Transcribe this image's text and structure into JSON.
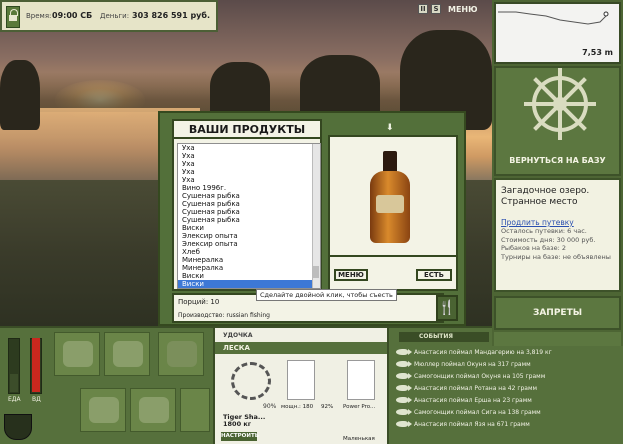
{
  "status": {
    "time_label": "Время:",
    "time_value": "09:00 СБ",
    "money_label": "Деньги:",
    "money_value": "303 826 591 руб."
  },
  "top_buttons": {
    "b1": "II",
    "b2": "S",
    "menu": "МЕНЮ"
  },
  "minimap": {
    "depth": "7,53 m"
  },
  "right_panel": {
    "back_to_base": "ВЕРНУТЬСЯ НА БАЗУ",
    "lake_name": "Загадочное озеро. Странное место",
    "extend_link": "Продлить путевку",
    "lines": [
      "Осталось путевки: 6 час.",
      "Стоимость дня: 30 000 руб.",
      "Рыбаков на базе: 2",
      "Турниры на базе: не объявлены"
    ],
    "bans": "ЗАПРЕТЫ"
  },
  "dialog": {
    "title": "ВАШИ ПРОДУКТЫ",
    "items": [
      "Уха",
      "Уха",
      "Уха",
      "Уха",
      "Уха",
      "Вино 1996г.",
      "Сушеная рыбка",
      "Сушеная рыбка",
      "Сушеная рыбка",
      "Сушеная рыбка",
      "Виски",
      "Элексир опыта",
      "Элексир опыта",
      "Хлеб",
      "Минералка",
      "Минералка",
      "Виски",
      "Виски"
    ],
    "selected_index": 17,
    "menu_btn": "МЕНЮ",
    "eat_btn": "ЕСТЬ",
    "arrow": "⬇",
    "portions": "Порций: 10",
    "maker": "Производство: russian fishing",
    "tooltip": "Сделайте двойной клик, чтобы съесть",
    "eat_icon": "🍴"
  },
  "bottom": {
    "gauge_left_label": "ЕДА",
    "gauge_right_label": "ВД",
    "tackle_top": "УДОЧКА",
    "tackle_header": "ЛЕСКА",
    "rod_name": "Tiger Sha...\n1800 кг",
    "rod_pct": "90%",
    "setup": "НАСТРОИТЬ",
    "line_label": "мощн.: 180",
    "line_pct": "92%",
    "lure_label": "Power Pro...",
    "small_label": "Маленькая",
    "events_tab": "СОБЫТИЯ"
  },
  "feed": [
    "Анастасия поймал Мандагерию на 3,819 кг",
    "Мюллер поймал Окуня на 317 грамм",
    "Самогонщик поймал Окуня на 105 грамм",
    "Анастасия поймал Ротана на 42 грамм",
    "Анастасия поймал Ерша на 23 грамм",
    "Самогонщик поймал Сига на 138 грамм",
    "Анастасия поймал Язя на 671 грамм"
  ]
}
